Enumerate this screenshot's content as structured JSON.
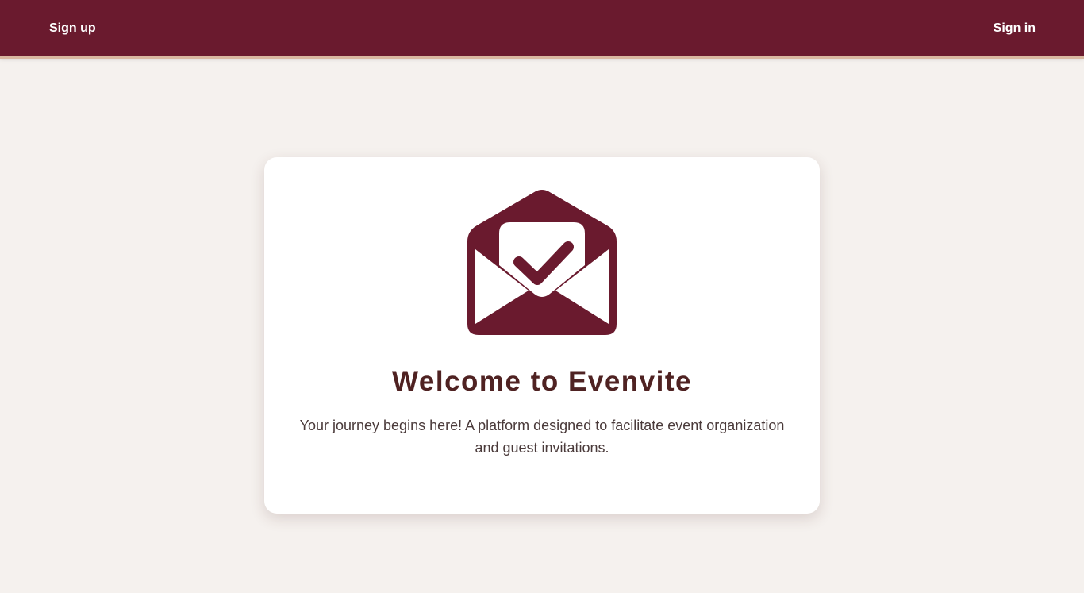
{
  "nav": {
    "signup_label": "Sign up",
    "signin_label": "Sign in"
  },
  "hero": {
    "icon": "envelope-check-icon",
    "title": "Welcome to Evenvite",
    "description": "Your journey begins here! A platform designed to facilitate event organization and guest invitations."
  },
  "colors": {
    "brand": "#6a1a2e",
    "accent_border": "#d9b7a0",
    "background": "#f5f1ee",
    "title_text": "#4f2222",
    "body_text": "#4a3a3a"
  }
}
